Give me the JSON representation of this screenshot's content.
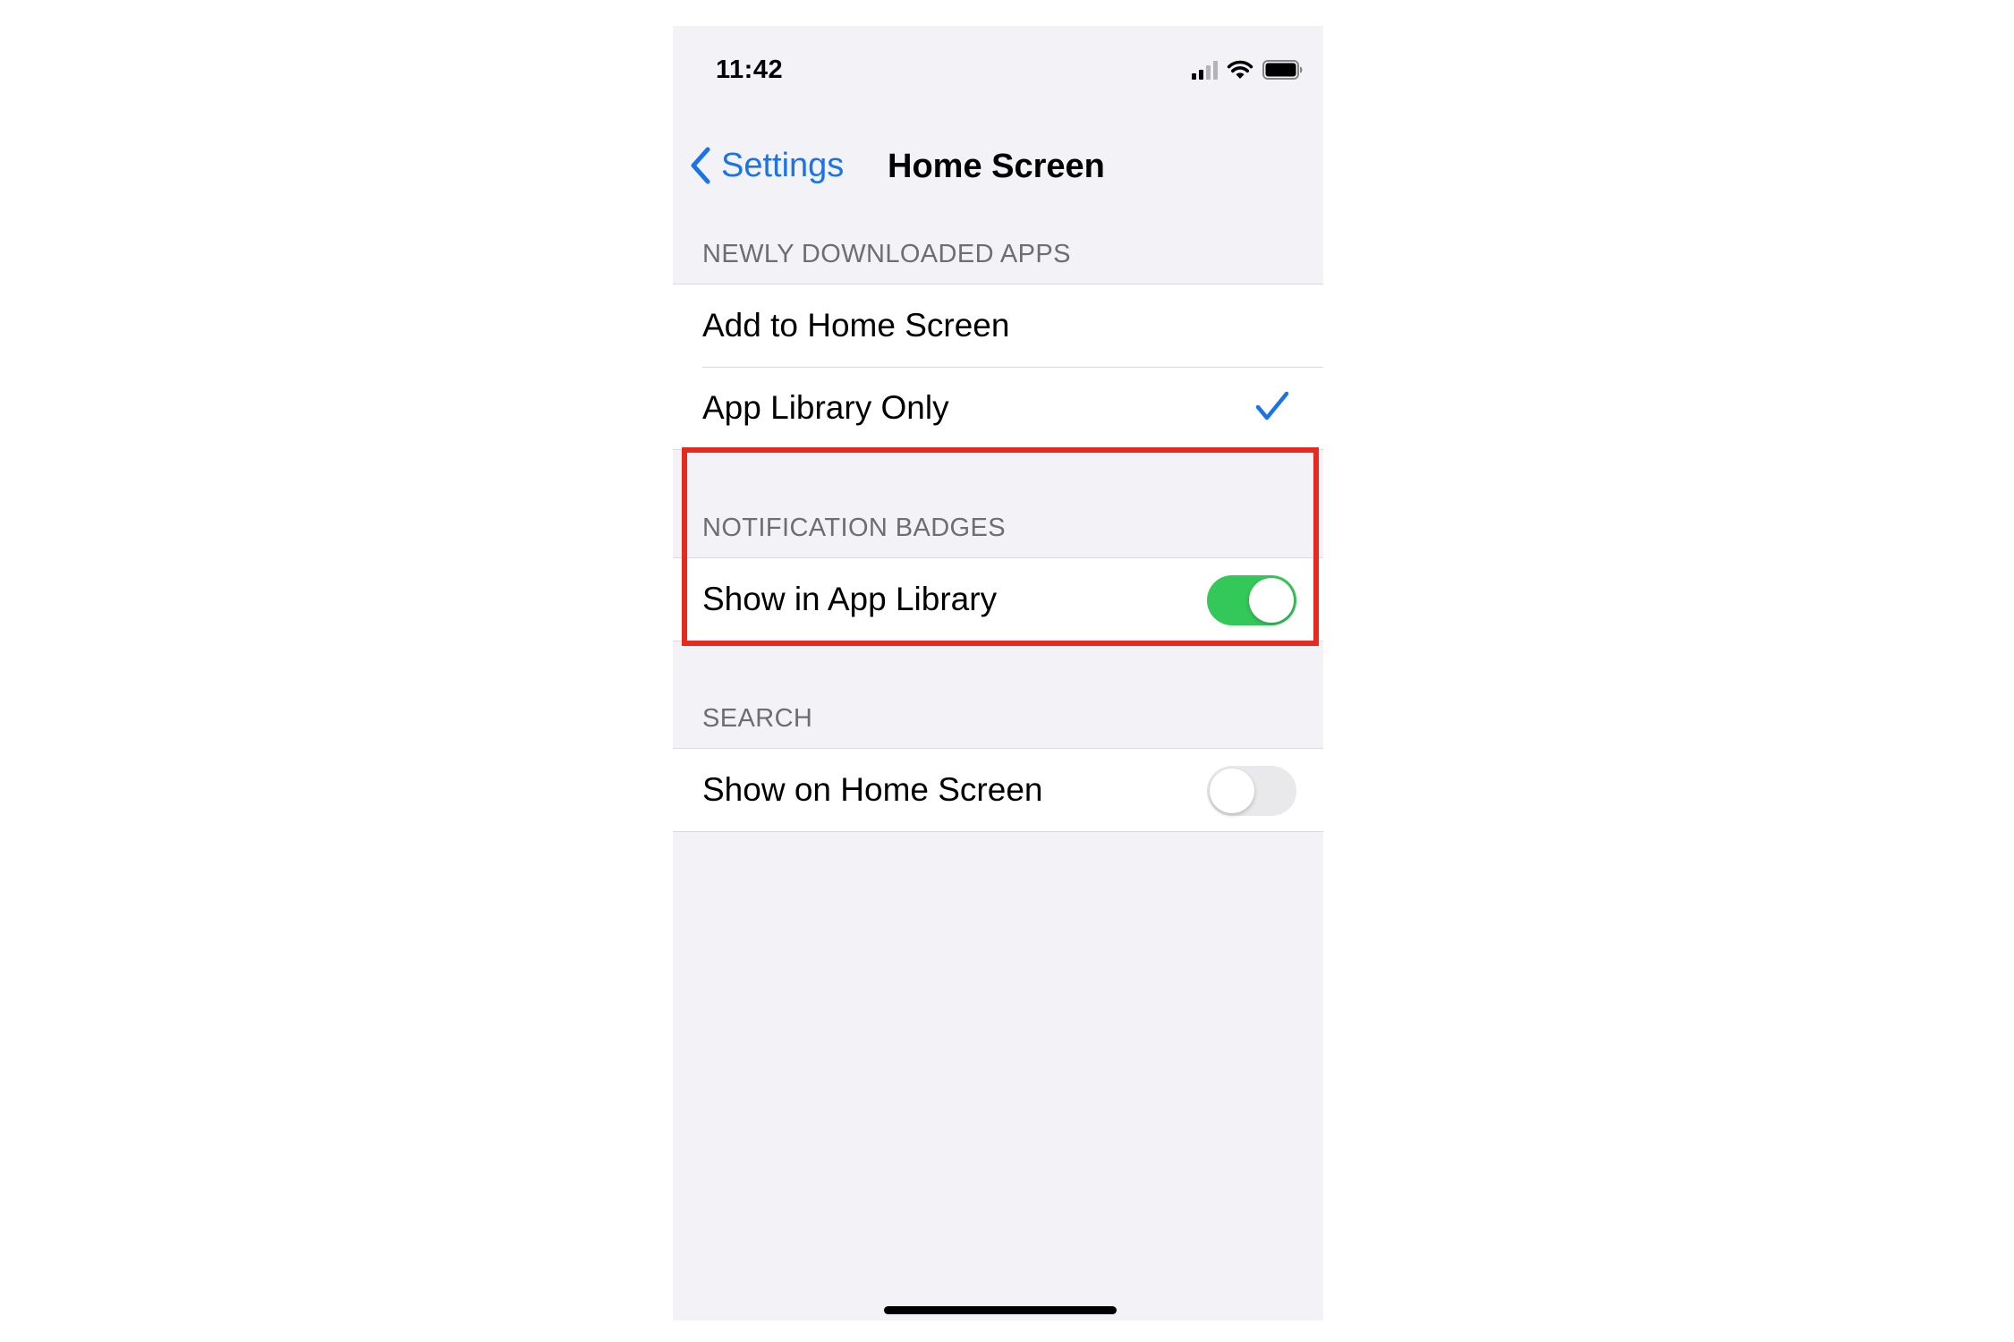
{
  "status_bar": {
    "time": "11:42",
    "icons": [
      "cellular-signal-icon",
      "wifi-icon",
      "battery-icon"
    ]
  },
  "nav": {
    "back_label": "Settings",
    "back_icon": "chevron-left-icon",
    "title": "Home Screen"
  },
  "sections": {
    "newly_downloaded": {
      "header": "NEWLY DOWNLOADED APPS",
      "items": [
        {
          "label": "Add to Home Screen",
          "selected": false
        },
        {
          "label": "App Library Only",
          "selected": true,
          "accessory_icon": "checkmark-icon"
        }
      ]
    },
    "notification_badges": {
      "header": "NOTIFICATION BADGES",
      "items": [
        {
          "label": "Show in App Library",
          "toggle_on": true
        }
      ]
    },
    "search": {
      "header": "SEARCH",
      "items": [
        {
          "label": "Show on Home Screen",
          "toggle_on": false
        }
      ]
    }
  },
  "colors": {
    "accent": "#1a73e8",
    "toggle_on": "#34c759",
    "toggle_off": "#e9e9eb",
    "highlight": "#e8291d",
    "background": "#f2f2f7"
  }
}
